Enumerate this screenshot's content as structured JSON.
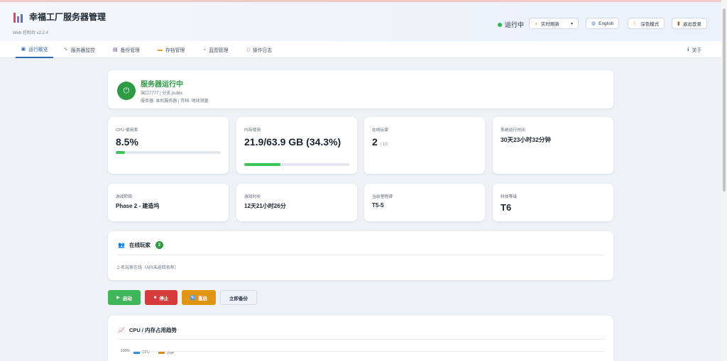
{
  "header": {
    "title": "幸福工厂服务器管理",
    "subtitle": "Web 控制台 v2.2.4",
    "status": "运行中",
    "refresh_select": "实时刷新",
    "language_btn": "English",
    "theme_btn": "深色模式",
    "logout_btn": "退出登录"
  },
  "nav": {
    "tabs": [
      {
        "label": "运行概览",
        "icon": "dashboard-icon",
        "active": true
      },
      {
        "label": "服务器监控",
        "icon": "wrench-icon"
      },
      {
        "label": "备份管理",
        "icon": "save-icon"
      },
      {
        "label": "存档管理",
        "icon": "folder-icon"
      },
      {
        "label": "蓝图管理",
        "icon": "blueprint-icon"
      },
      {
        "label": "操作日志",
        "icon": "clipboard-icon"
      }
    ],
    "about": "关于"
  },
  "server": {
    "status_title": "服务器运行中",
    "line1": "端口7777 | 分支:public",
    "line2": "服务器: 本机服务器 | 存档: 地球测量"
  },
  "stats": {
    "cpu": {
      "label": "CPU 使用率",
      "value": "8.5%",
      "percent": 8.5
    },
    "memory": {
      "label": "内存使用",
      "value": "21.9/63.9 GB (34.3%)",
      "percent": 34.3
    },
    "players": {
      "label": "在线玩家",
      "value": "2",
      "max": "/ 10"
    },
    "uptime": {
      "label": "系统运行时间",
      "value": "30天23小时32分钟"
    },
    "phase": {
      "label": "游戏阶段",
      "value": "Phase 2 - 建造坞"
    },
    "playtime": {
      "label": "游戏时长",
      "value": "12天21小时26分"
    },
    "milestone": {
      "label": "当前里程碑",
      "value": "T5-5"
    },
    "tech": {
      "label": "科技等级",
      "value": "T6"
    }
  },
  "players_section": {
    "title": "在线玩家",
    "count": "2",
    "note": "2 名玩家在线（API未返回名称）"
  },
  "actions": {
    "start": "启动",
    "stop": "停止",
    "restart": "重启",
    "backup": "立即备份"
  },
  "trend": {
    "title": "CPU / 内存占用趋势",
    "y_tick": "100%",
    "legend_cpu": "CPU",
    "legend_mem": "内存"
  },
  "colors": {
    "accent": "#2b6cb0",
    "running": "#2f9a45",
    "start": "#3fb65a",
    "stop": "#d63a3a",
    "restart": "#e09514",
    "cpu_line": "#3a8ed8",
    "mem_line": "#e08a1c"
  }
}
